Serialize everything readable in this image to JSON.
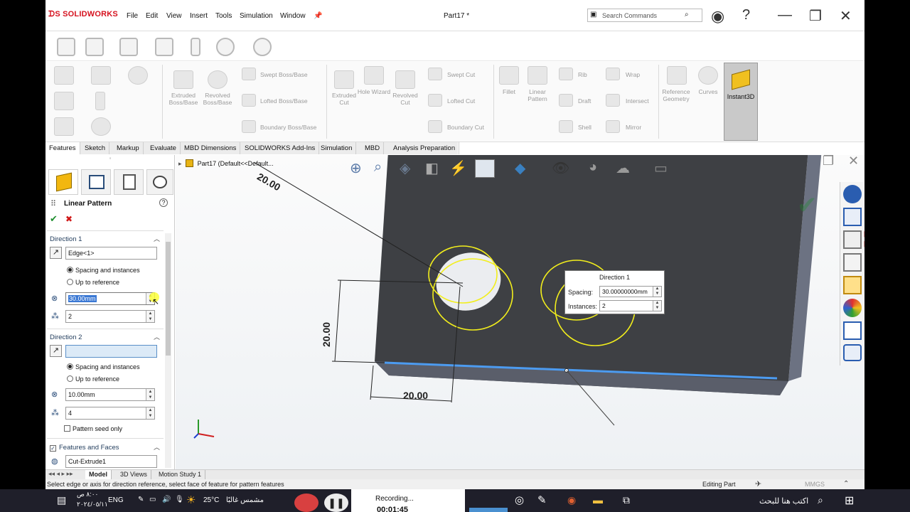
{
  "app": {
    "logo": "SOLIDWORKS",
    "menu": [
      "File",
      "Edit",
      "View",
      "Insert",
      "Tools",
      "Simulation",
      "Window"
    ],
    "doc_title": "Part17 *",
    "search_placeholder": "Search Commands"
  },
  "ribbon": {
    "boss": [
      "Extruded Boss/Base",
      "Revolved Boss/Base"
    ],
    "boss_small": [
      "Swept Boss/Base",
      "Lofted Boss/Base",
      "Boundary Boss/Base"
    ],
    "cut": [
      "Extruded Cut",
      "Hole Wizard",
      "Revolved Cut"
    ],
    "cut_small": [
      "Swept Cut",
      "Lofted Cut",
      "Boundary Cut"
    ],
    "features": [
      "Fillet",
      "Linear Pattern"
    ],
    "features_small": [
      "Rib",
      "Draft",
      "Shell",
      "Wrap",
      "Intersect",
      "Mirror"
    ],
    "ref": [
      "Reference Geometry",
      "Curves"
    ],
    "instant3d": "Instant3D"
  },
  "tabs": [
    "Features",
    "Sketch",
    "Markup",
    "Evaluate",
    "MBD Dimensions",
    "SOLIDWORKS Add-Ins",
    "Simulation",
    "MBD",
    "Analysis Preparation"
  ],
  "panel": {
    "title": "Linear Pattern",
    "help": "?",
    "ok": "✔",
    "cancel": "✖",
    "dir1": {
      "header": "Direction 1",
      "edge": "Edge<1>",
      "opt_spacing": "Spacing and instances",
      "opt_ref": "Up to reference",
      "spacing": "30.00mm",
      "instances": "2"
    },
    "dir2": {
      "header": "Direction 2",
      "edge": "",
      "opt_spacing": "Spacing and instances",
      "opt_ref": "Up to reference",
      "spacing": "10.00mm",
      "instances": "4",
      "seed_only": "Pattern seed only"
    },
    "faf": {
      "header": "Features and Faces",
      "item": "Cut-Extrude1"
    }
  },
  "tree": {
    "root": "Part17  (Default<<Default..."
  },
  "model": {
    "dim_top": "20.00",
    "dim_left": "20.00",
    "dim_bottom": "20.00"
  },
  "dir_popup": {
    "title": "Direction 1",
    "spacing_label": "Spacing:",
    "spacing_value": "30.00000000mm",
    "instances_label": "Instances:",
    "instances_value": "2"
  },
  "bottom_tabs": [
    "Model",
    "3D Views",
    "Motion Study 1"
  ],
  "status": {
    "message": "Select edge or axis for direction reference, select face of feature for pattern features",
    "mode": "Editing Part",
    "units": "MMGS"
  },
  "taskbar": {
    "search": "اكتب هنا للبحث",
    "recording": "Recording...",
    "timer": "00:01:45",
    "weather": "25°C",
    "weather_desc": "مشمس غالبًا",
    "lang": "ENG",
    "time": "٨:٠٠ ص",
    "date": "٢٠٢٤/٠٥/١١"
  },
  "colors": {
    "brand": "#d6121f",
    "model_face": "#3e4044",
    "sketch_yellow": "#f2ee1c",
    "edge_blue": "#4c9bf0",
    "accent_green": "#1e8e2e",
    "accent_red": "#d01818"
  }
}
